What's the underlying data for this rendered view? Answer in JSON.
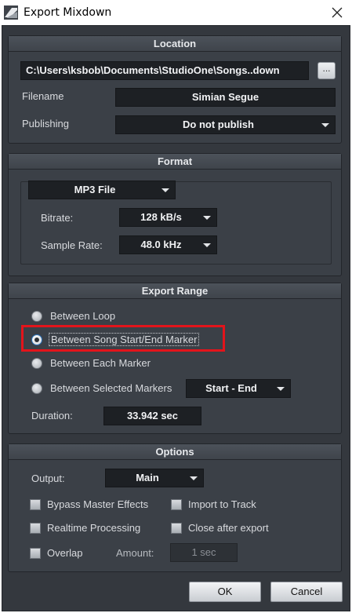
{
  "window": {
    "title": "Export Mixdown",
    "icon": "studio-one-logo-icon",
    "close_icon": "close-icon"
  },
  "location": {
    "header": "Location",
    "path": "C:\\Users\\ksbob\\Documents\\StudioOne\\Songs..down",
    "browse_label": "...",
    "filename_label": "Filename",
    "filename_value": "Simian Segue",
    "publishing_label": "Publishing",
    "publishing_value": "Do not publish"
  },
  "format": {
    "header": "Format",
    "file_type": "MP3 File",
    "bitrate_label": "Bitrate:",
    "bitrate_value": "128 kB/s",
    "samplerate_label": "Sample Rate:",
    "samplerate_value": "48.0 kHz"
  },
  "export_range": {
    "header": "Export Range",
    "options": [
      {
        "label": "Between Loop",
        "selected": false
      },
      {
        "label": "Between Song Start/End Marker",
        "selected": true
      },
      {
        "label": "Between Each Marker",
        "selected": false
      },
      {
        "label": "Between Selected Markers",
        "selected": false
      }
    ],
    "selected_markers_value": "Start - End",
    "duration_label": "Duration:",
    "duration_value": "33.942 sec"
  },
  "options": {
    "header": "Options",
    "output_label": "Output:",
    "output_value": "Main",
    "bypass_label": "Bypass Master Effects",
    "import_label": "Import to Track",
    "realtime_label": "Realtime Processing",
    "close_label": "Close after export",
    "overlap_label": "Overlap",
    "amount_label": "Amount:",
    "amount_value": "1 sec"
  },
  "buttons": {
    "ok": "OK",
    "cancel": "Cancel"
  },
  "colors": {
    "panel": "#3b4047",
    "background": "#34383e",
    "highlight": "#e3141b"
  }
}
